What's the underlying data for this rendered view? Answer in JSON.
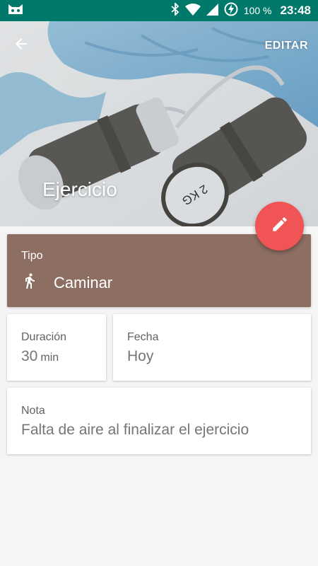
{
  "status_bar": {
    "battery": "100 %",
    "time": "23:48",
    "icons": [
      "cat-icon",
      "bluetooth-icon",
      "wifi-icon",
      "signal-icon",
      "battery-charging-icon"
    ]
  },
  "header": {
    "back_icon": "arrow-back-icon",
    "edit_label": "EDITAR",
    "title": "Ejercicio",
    "fab_icon": "pencil-icon",
    "image_text": "2 KG"
  },
  "tipo": {
    "label": "Tipo",
    "icon": "walk-icon",
    "value": "Caminar"
  },
  "duracion": {
    "label": "Duración",
    "value": "30",
    "unit": "min"
  },
  "fecha": {
    "label": "Fecha",
    "value": "Hoy"
  },
  "nota": {
    "label": "Nota",
    "value": "Falta de aire al finalizar el ejercicio"
  },
  "colors": {
    "status_bar": "#00796b",
    "tipo_card": "#8d6e63",
    "fab": "#f05454",
    "background": "#f5f5f5"
  }
}
